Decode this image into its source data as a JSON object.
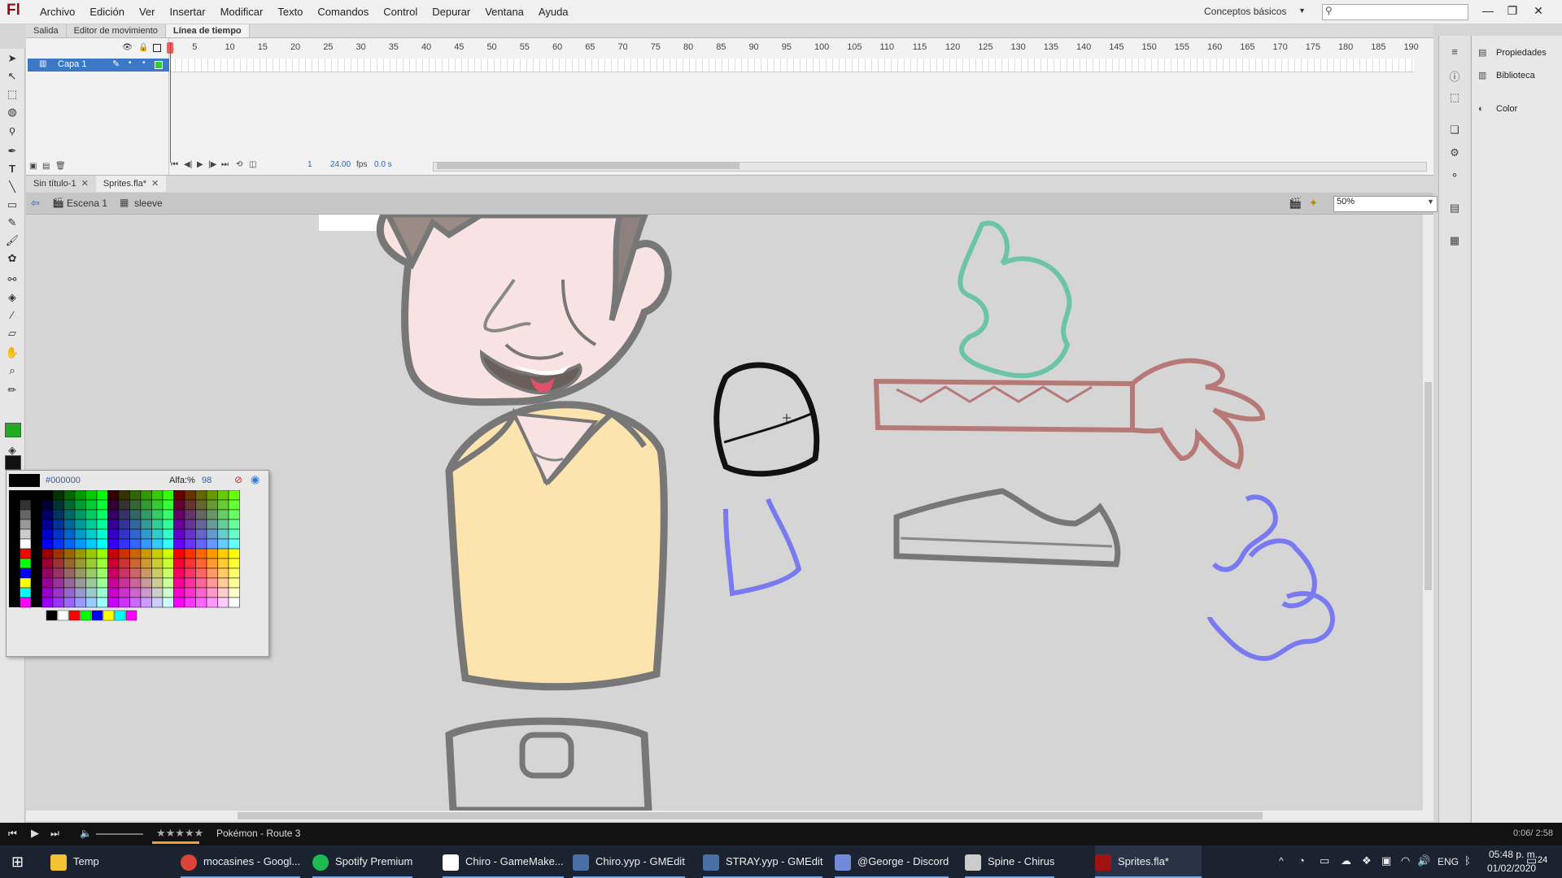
{
  "app": {
    "logo": "Fl",
    "menus": [
      "Archivo",
      "Edición",
      "Ver",
      "Insertar",
      "Modificar",
      "Texto",
      "Comandos",
      "Control",
      "Depurar",
      "Ventana",
      "Ayuda"
    ],
    "workspace": "Conceptos básicos",
    "search_placeholder": ""
  },
  "panel_tabs": [
    "Salida",
    "Editor de movimiento",
    "Línea de tiempo"
  ],
  "timeline": {
    "layer_name": "Capa 1",
    "frame_numbers": [
      "1",
      "5",
      "10",
      "15",
      "20",
      "25",
      "30",
      "35",
      "40",
      "45",
      "50",
      "55",
      "60",
      "65",
      "70",
      "75",
      "80",
      "85",
      "90",
      "95",
      "100",
      "105",
      "110",
      "115",
      "120",
      "125",
      "130",
      "135",
      "140",
      "145",
      "150",
      "155",
      "160",
      "165",
      "170",
      "175",
      "180",
      "185",
      "190"
    ],
    "current_frame": "1",
    "fps": "24.00",
    "fps_unit": "fps",
    "elapsed": "0.0 s"
  },
  "doc_tabs": [
    {
      "label": "Sin título-1",
      "active": false
    },
    {
      "label": "Sprites.fla*",
      "active": true
    }
  ],
  "scene": {
    "scene_label": "Escena 1",
    "symbol_label": "sleeve",
    "zoom": "50%"
  },
  "right_panels": [
    "Propiedades",
    "Biblioteca",
    "Color"
  ],
  "swatch": {
    "hex": "#000000",
    "alpha_label": "Alfa:%",
    "alpha_value": "98"
  },
  "colors": {
    "tool_fill": "#22aa22",
    "tool_stroke": "#111111",
    "green_sketch": "#6cc4a6",
    "red_sketch": "#b77878",
    "blue_sketch": "#7a7af0",
    "shirt": "#fde3ae",
    "skin": "#f9e2e2",
    "outline": "#777777"
  },
  "media": {
    "track": "Pokémon - Route 3",
    "time": "0:06/ 2:58"
  },
  "taskbar": {
    "items": [
      {
        "label": "Temp",
        "icon": "folder-icon"
      },
      {
        "label": "mocasines - Googl...",
        "icon": "chrome-icon"
      },
      {
        "label": "Spotify Premium",
        "icon": "spotify-icon"
      },
      {
        "label": "Chiro - GameMake...",
        "icon": "gamemaker-icon"
      },
      {
        "label": "Chiro.yyp - GMEdit",
        "icon": "gmedit-icon"
      },
      {
        "label": "STRAY.yyp - GMEdit",
        "icon": "gmedit-icon"
      },
      {
        "label": "@George - Discord",
        "icon": "discord-icon"
      },
      {
        "label": "Spine - Chirus",
        "icon": "spine-icon"
      },
      {
        "label": "Sprites.fla*",
        "icon": "flash-icon"
      }
    ],
    "lang": "ENG",
    "time": "05:48 p. m.",
    "date": "01/02/2020",
    "notifications": "24"
  }
}
